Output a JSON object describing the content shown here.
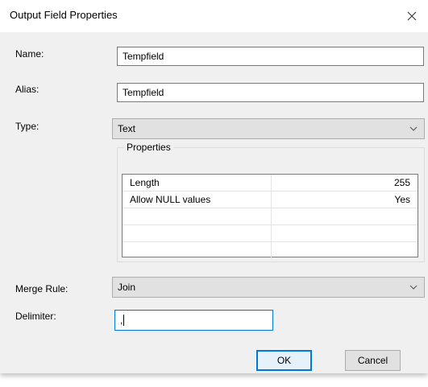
{
  "dialog": {
    "title": "Output Field Properties"
  },
  "fields": {
    "name": {
      "label": "Name:",
      "value": "Tempfield"
    },
    "alias": {
      "label": "Alias:",
      "value": "Tempfield"
    },
    "type": {
      "label": "Type:",
      "value": "Text"
    },
    "merge_rule": {
      "label": "Merge Rule:",
      "value": "Join"
    },
    "delimiter": {
      "label": "Delimiter:",
      "value": ","
    }
  },
  "properties": {
    "title": "Properties",
    "rows": [
      {
        "name": "Length",
        "value": "255"
      },
      {
        "name": "Allow NULL values",
        "value": "Yes"
      },
      {
        "name": "",
        "value": ""
      },
      {
        "name": "",
        "value": ""
      },
      {
        "name": "",
        "value": ""
      }
    ]
  },
  "buttons": {
    "ok": "OK",
    "cancel": "Cancel"
  },
  "icons": {
    "close": "close-icon",
    "dropdown": "chevron-down-icon"
  },
  "colors": {
    "focus": "#0078d7",
    "dialog_bg": "#f0f0f0"
  }
}
